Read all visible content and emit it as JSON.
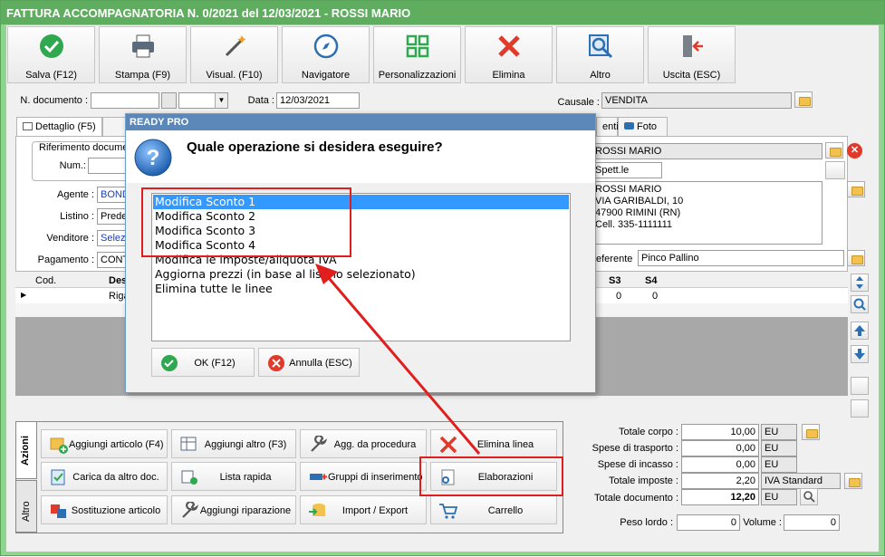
{
  "window": {
    "title": "FATTURA ACCOMPAGNATORIA N. 0/2021 del 12/03/2021 - ROSSI MARIO"
  },
  "toolbar": [
    {
      "label": "Salva (F12)",
      "icon": "check-circle-icon"
    },
    {
      "label": "Stampa (F9)",
      "icon": "printer-icon"
    },
    {
      "label": "Visual. (F10)",
      "icon": "magic-wand-icon"
    },
    {
      "label": "Navigatore",
      "icon": "compass-icon"
    },
    {
      "label": "Personalizzazioni",
      "icon": "grid-icon"
    },
    {
      "label": "Elimina",
      "icon": "red-x-icon"
    },
    {
      "label": "Altro",
      "icon": "magnifier-icon"
    },
    {
      "label": "Uscita (ESC)",
      "icon": "exit-door-icon"
    }
  ],
  "header": {
    "doc_label": "N. documento :",
    "data_label": "Data :",
    "data_value": "12/03/2021",
    "causale_label": "Causale :",
    "causale_value": "VENDITA"
  },
  "tabs": {
    "dettaglio": "Dettaglio (F5)",
    "enti": "enti",
    "foto": "Foto"
  },
  "left_form": {
    "riferimento": "Riferimento documen",
    "num": "Num.:",
    "agente_label": "Agente :",
    "agente_value": "BOND",
    "listino_label": "Listino :",
    "listino_value": "Prede",
    "venditore_label": "Venditore :",
    "venditore_value": "Selezi",
    "pagamento_label": "Pagamento :",
    "pagamento_value": "CONT"
  },
  "customer": {
    "name": "ROSSI MARIO",
    "title": "Spett.le",
    "address_lines": [
      "ROSSI MARIO",
      "VIA GARIBALDI, 10",
      "47900 RIMINI (RN)",
      "Cell. 335-1111111"
    ],
    "referente_label": "eferente",
    "referente_value": "Pinco Pallino"
  },
  "grid": {
    "columns": [
      "Cod.",
      "Des",
      "S3",
      "S4"
    ],
    "row_desc": "Riga",
    "s3": "0",
    "s4": "0"
  },
  "dialog": {
    "title": "READY PRO",
    "question": "Quale operazione si desidera eseguire?",
    "options": [
      "Modifica Sconto 1",
      "Modifica Sconto 2",
      "Modifica Sconto 3",
      "Modifica Sconto 4",
      "Modifica le imposte/aliquota IVA",
      "Aggiorna prezzi (in base al listino selezionato)",
      "Elimina tutte le linee"
    ],
    "ok": "OK (F12)",
    "annulla": "Annulla (ESC)"
  },
  "side_tabs": {
    "azioni": "Azioni",
    "altro": "Altro"
  },
  "actions": [
    {
      "label": "Aggiungi articolo (F4)",
      "icon": "add-article-icon"
    },
    {
      "label": "Aggiungi altro (F3)",
      "icon": "table-add-icon"
    },
    {
      "label": "Agg. da procedura",
      "icon": "wrench-icon"
    },
    {
      "label": "Elimina linea",
      "icon": "red-x-icon"
    },
    {
      "label": "Carica da altro doc.",
      "icon": "doc-check-icon"
    },
    {
      "label": "Lista rapida",
      "icon": "quick-list-icon"
    },
    {
      "label": "Gruppi di inserimento",
      "icon": "group-insert-icon"
    },
    {
      "label": "Elaborazioni",
      "icon": "gear-doc-icon"
    },
    {
      "label": "Sostituzione articolo",
      "icon": "swap-icon"
    },
    {
      "label": "Aggiungi riparazione",
      "icon": "wrench-icon"
    },
    {
      "label": "Import / Export",
      "icon": "database-arrow-icon"
    },
    {
      "label": "Carrello",
      "icon": "cart-icon"
    }
  ],
  "totals": {
    "corpo_label": "Totale corpo :",
    "corpo_value": "10,00",
    "corpo_cur": "EU",
    "trasporto_label": "Spese di trasporto :",
    "trasporto_value": "0,00",
    "trasporto_cur": "EU",
    "incasso_label": "Spese di incasso :",
    "incasso_value": "0,00",
    "incasso_cur": "EU",
    "imposte_label": "Totale imposte :",
    "imposte_value": "2,20",
    "imposte_cur": "IVA Standard",
    "documento_label": "Totale documento :",
    "documento_value": "12,20",
    "documento_cur": "EU",
    "peso_lordo_label": "Peso lordo :",
    "peso_lordo_value": "0",
    "volume_label": "Volume :",
    "volume_value": "0"
  },
  "colors": {
    "window_green": "#8ed58e",
    "title_green": "#5fae5f",
    "highlight_red": "#e01e1e",
    "selection_blue": "#3399ff"
  }
}
